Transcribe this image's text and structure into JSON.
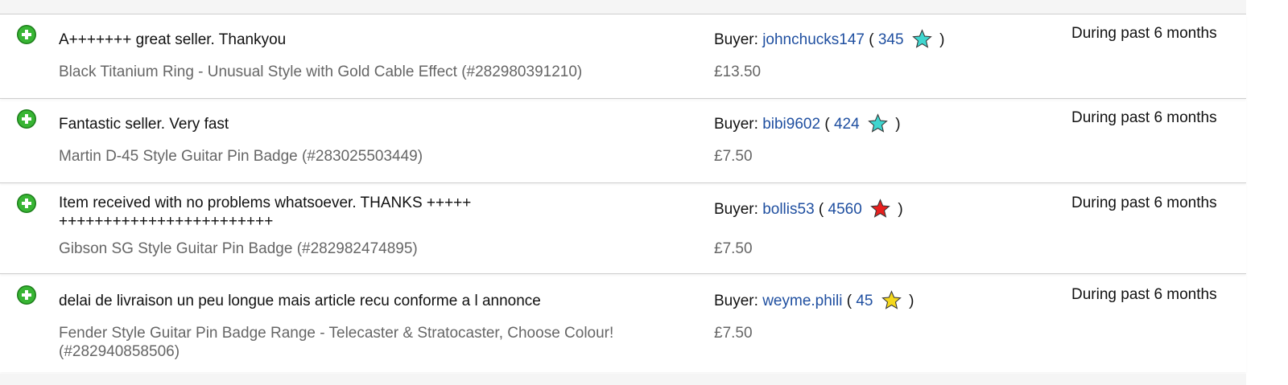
{
  "feedback": [
    {
      "comment": "A+++++++ great seller. Thankyou",
      "item": "Black Titanium Ring - Unusual Style with Gold Cable Effect (#282980391210)",
      "buyer_label": "Buyer:",
      "buyer_name": "johnchucks147",
      "score": "345",
      "star_color": "#3fd6cf",
      "price": "£13.50",
      "period": "During past 6 months"
    },
    {
      "comment": "Fantastic seller. Very fast",
      "item": "Martin D-45 Style Guitar Pin Badge (#283025503449)",
      "buyer_label": "Buyer:",
      "buyer_name": "bibi9602",
      "score": "424",
      "star_color": "#3fd6cf",
      "price": "£7.50",
      "period": "During past 6 months"
    },
    {
      "comment": "Item received with no problems whatsoever. THANKS +++++++++++++++++++++++++++++",
      "item": "Gibson SG Style Guitar Pin Badge (#282982474895)",
      "buyer_label": "Buyer:",
      "buyer_name": "bollis53",
      "score": "4560",
      "star_color": "#e8201e",
      "price": "£7.50",
      "period": "During past 6 months"
    },
    {
      "comment": "delai de livraison un peu longue mais article recu conforme a l annonce",
      "item": "Fender Style Guitar Pin Badge Range - Telecaster & Stratocaster, Choose Colour! (#282940858506)",
      "buyer_label": "Buyer:",
      "buyer_name": "weyme.phili",
      "score": "45",
      "star_color": "#f5d81c",
      "price": "£7.50",
      "period": "During past 6 months"
    }
  ],
  "icons": {
    "rating": "positive-feedback-icon",
    "star": "feedback-star-icon"
  },
  "colors": {
    "positive_green": "#2fa82b",
    "link_blue": "#1f4fa0"
  }
}
